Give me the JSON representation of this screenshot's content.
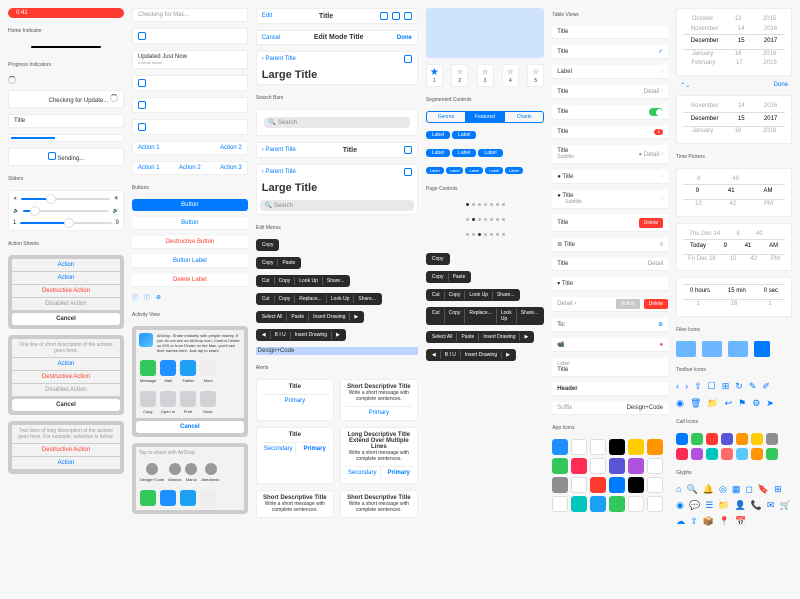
{
  "col1": {
    "home_indicator_section": "Home Indicator",
    "progress_section": "Progress Indicators",
    "checking": "Checking for Update...",
    "title": "Title",
    "sending": "Sending...",
    "sliders_section": "Sliders",
    "slider_min": "1",
    "slider_max": "9",
    "sheets_section": "Action Sheets",
    "action": "Action",
    "destructive": "Destructive Action",
    "disabled": "Disabled Action",
    "cancel": "Cancel",
    "desc1": "One line of short description of the actions goes here.",
    "desc2": "Two lines of long description of the actions goes here. For example, selection is below."
  },
  "col2": {
    "checking_mac": "Checking for Mac...",
    "updated": "Updated Just Now",
    "updated_sub": "3 items found",
    "action1": "Action 1",
    "action2": "Action 2",
    "action3": "Action 3",
    "buttons_section": "Buttons",
    "button": "Button",
    "destructive_btn": "Destructive Button",
    "button_label": "Button Label",
    "delete_label": "Delete Label",
    "activity_section": "Activity View",
    "airdrop": "AirDrop. Share instantly with people nearby. If you do not see an AirDrop icon, Control Center on iOS or from Finder on the Mac, you'll see their names here. Just tap to share.",
    "share_apps": [
      "Message",
      "Mail",
      "Twitter",
      "More"
    ],
    "share_actions": [
      "Copy",
      "Open In",
      "Print",
      "More"
    ],
    "cancel": "Cancel",
    "tap_share": "Tap to share with AirDrop",
    "people": [
      "Design+Code",
      "Marcus",
      "Marco",
      "Abednedo"
    ]
  },
  "col3": {
    "edit": "Edit",
    "title": "Title",
    "cancel": "Cancel",
    "edit_mode": "Edit Mode Title",
    "done": "Done",
    "parent": "Parent Title",
    "large_title": "Large Title",
    "searchbars_section": "Search Bars",
    "search_ph": "Search",
    "editmenus_section": "Edit Menus",
    "copy": "Copy",
    "paste": "Paste",
    "cut": "Cut",
    "lookup": "Look Up",
    "share": "Share...",
    "selectall": "Select All",
    "insert": "Insert Drawing",
    "biu": "B I U",
    "selection": "Design+Code",
    "alerts_section": "Alerts",
    "alert_title": "Title",
    "alert_msg": "Write a short message with complete sentences.",
    "primary": "Primary",
    "secondary": "Secondary",
    "short_title": "Short Descriptive Title",
    "long_title": "Long Descriptive Title Extend Over Multiple Lines"
  },
  "col4": {
    "segmented_section": "Segmented Controls",
    "genres": "Genres",
    "featured": "Featured",
    "charts": "Charts",
    "label": "Label",
    "pagecontrols_section": "Page Controls",
    "ratings": [
      "1",
      "2",
      "3",
      "4",
      "5"
    ],
    "star_labels": [
      "★",
      "☆",
      "☆",
      "☆",
      "☆"
    ]
  },
  "col5": {
    "tableviews_section": "Table Views",
    "title": "Title",
    "label": "Label",
    "detail": "Detail",
    "subtitle": "Subtitle",
    "delete": "Delete",
    "to": "To:",
    "header": "Header",
    "suffix": "Suffix",
    "suffix_val": "Design+Code",
    "appicons_section": "App Icons",
    "action": "Action",
    "badge1": "1"
  },
  "col6": {
    "months": [
      "October",
      "November",
      "December",
      "January",
      "February"
    ],
    "days": [
      "13",
      "14",
      "15",
      "16",
      "17"
    ],
    "years": [
      "2015",
      "2016",
      "2017",
      "2018",
      "2019"
    ],
    "done": "Done",
    "timepickers_section": "Time Pickers",
    "hours": [
      "8",
      "9",
      "10"
    ],
    "mins": [
      "40",
      "41",
      "42"
    ],
    "ampm": [
      "AM",
      "PM"
    ],
    "dates": [
      "Thu Dec 14",
      "Today",
      "Fri Dec 16"
    ],
    "th": [
      "8",
      "9",
      "10"
    ],
    "tm": [
      "40",
      "41",
      "42"
    ],
    "duration_h": "0 hours",
    "duration_m": "15 min",
    "duration_s": "0 sec",
    "fileicons_section": "Files Icons",
    "toolbaricons_section": "Toolbar Icons",
    "calicons_section": "Call Icons",
    "glyphs_section": "Glyphs"
  },
  "app_icon_colors": [
    "#1e90ff",
    "#fff",
    "#fff",
    "#000",
    "#fc0",
    "#ff9500",
    "#34c759",
    "#ff2d55",
    "#fff",
    "#5856d6",
    "#af52de",
    "#fff",
    "#8e8e93",
    "#fff",
    "#ff3b30",
    "#007aff",
    "#000",
    "#fff",
    "#fff",
    "#00c7be",
    "#1ba1f2",
    "#34c759",
    "#fff",
    "#fff"
  ],
  "call_colors": [
    "#007aff",
    "#34c759",
    "#ff3b30",
    "#5856d6",
    "#ff9500",
    "#ffcc00",
    "#8e8e93",
    "#ff2d55",
    "#af52de",
    "#00c7be",
    "#ff6b6b",
    "#5ac8fa",
    "#ff9500",
    "#34c759"
  ]
}
